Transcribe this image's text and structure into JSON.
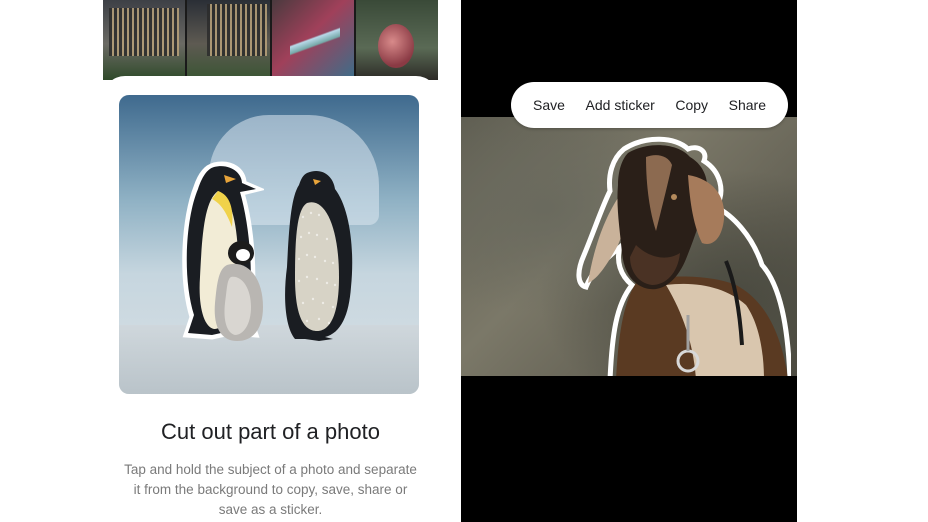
{
  "left": {
    "sheet": {
      "title": "Cut out part of a photo",
      "description": "Tap and hold the subject of a photo and separate it from the background to copy, save, share or save as a sticker."
    }
  },
  "right": {
    "context_menu": {
      "save_label": "Save",
      "add_sticker_label": "Add sticker",
      "copy_label": "Copy",
      "share_label": "Share"
    }
  },
  "colors": {
    "page_background": "#ffffff",
    "viewer_background": "#000000",
    "title_text": "#202124",
    "description_text": "#7a7a7a"
  }
}
